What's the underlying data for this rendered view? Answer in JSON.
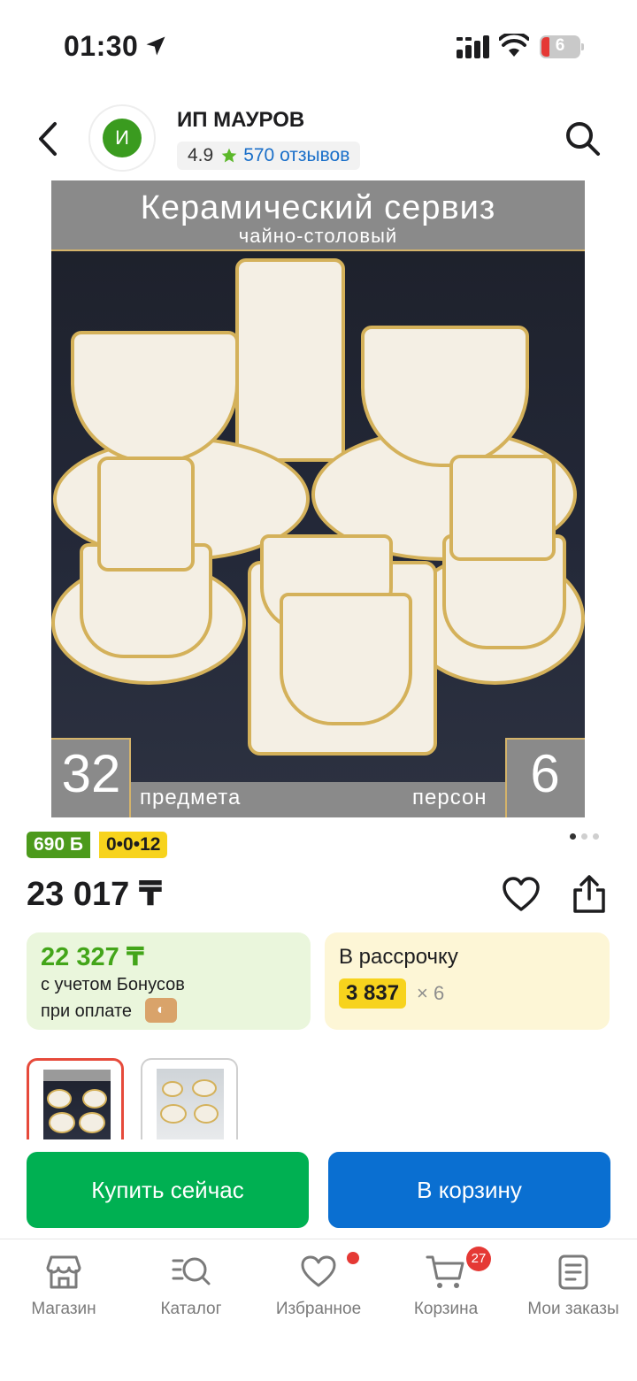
{
  "status_bar": {
    "time": "01:30",
    "battery": "6"
  },
  "header": {
    "shop_initial": "И",
    "shop_name": "ИП МАУРОВ",
    "rating": "4.9",
    "reviews": "570 отзывов"
  },
  "product_image": {
    "title": "Керамический сервиз",
    "subtitle": "чайно-столовый",
    "items_count": "32",
    "items_label": "предмета",
    "persons_count": "6",
    "persons_label": "персон"
  },
  "badges": {
    "bonus": "690 Б",
    "installment": "0•0•12"
  },
  "gallery": {
    "total_slides": 3,
    "active_slide": 1
  },
  "price": {
    "current": "23 017 ₸"
  },
  "bonus_card": {
    "price": "22 327 ₸",
    "line1": "с учетом Бонусов",
    "line2": "при оплате"
  },
  "installment_card": {
    "label": "В рассрочку",
    "amount": "3 837",
    "multiplier": "× 6"
  },
  "actions": {
    "buy_now": "Купить сейчас",
    "add_to_cart": "В корзину"
  },
  "tab_bar": {
    "items": [
      {
        "label": "Магазин",
        "icon": "store-icon"
      },
      {
        "label": "Каталог",
        "icon": "catalog-search-icon"
      },
      {
        "label": "Избранное",
        "icon": "heart-icon"
      },
      {
        "label": "Корзина",
        "icon": "cart-icon"
      },
      {
        "label": "Мои заказы",
        "icon": "orders-icon"
      }
    ],
    "cart_count": "27"
  },
  "colors": {
    "green": "#00b052",
    "blue": "#0a6fd1",
    "bonus_green": "#43a519",
    "yellow": "#f7d31d",
    "red": "#e53935",
    "link_blue": "#1a6fc9"
  }
}
